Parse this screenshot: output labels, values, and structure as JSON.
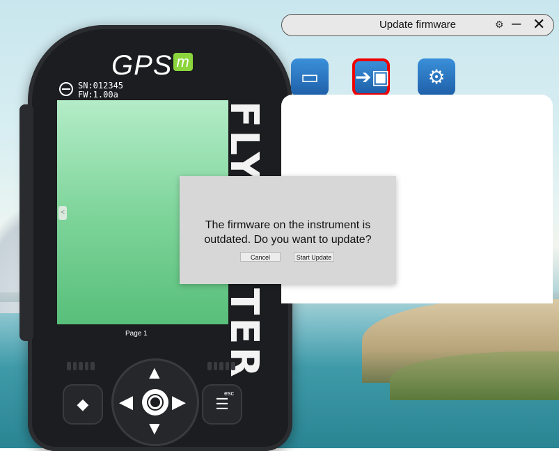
{
  "window": {
    "title": "Update firmware",
    "settings_icon": "gear-icon",
    "minimize_label": "–",
    "close_label": "✕"
  },
  "toolbar": [
    {
      "name": "files",
      "icon": "document-stack-icon"
    },
    {
      "name": "firmware",
      "icon": "chip-arrow-icon",
      "selected": true
    },
    {
      "name": "settings",
      "icon": "sliders-icon"
    }
  ],
  "device": {
    "brand": "GPS",
    "brand_mark": "m",
    "serial": "SN:012345",
    "firmware": "FW:1.00a",
    "side_text": "FLYMASTER",
    "page_label": "Page 1",
    "screen_tab": "<",
    "menu_label": "esc"
  },
  "dialog": {
    "message_line1": "The firmware on the instrument is",
    "message_line2": "outdated. Do you want to update?",
    "cancel_label": "Cancel",
    "start_label": "Start Update"
  },
  "colors": {
    "accent": "#1e5fa8",
    "selected_border": "#ee0000",
    "screen": "#7fd59b"
  }
}
